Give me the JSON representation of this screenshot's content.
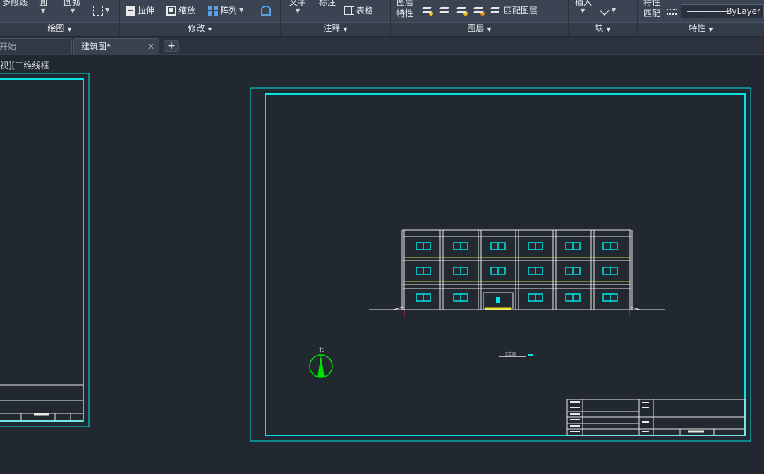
{
  "ribbon": {
    "draw": {
      "polyline_label": "多段线",
      "circle_label": "圆",
      "arc_label": "圆弧",
      "panel_title": "绘图"
    },
    "modify": {
      "stretch_label": "拉伸",
      "scale_label": "缩放",
      "array_label": "阵列",
      "panel_title": "修改"
    },
    "annotation": {
      "text_label": "文字",
      "dimension_label": "标注",
      "table_label": "表格",
      "panel_title": "注释"
    },
    "layers": {
      "layer_props_line1": "图层",
      "layer_props_line2": "特性",
      "match_layer_label": "匹配图层",
      "panel_title": "图层"
    },
    "block": {
      "insert_label": "插入",
      "panel_title": "块"
    },
    "properties": {
      "match_line1": "特性",
      "match_line2": "匹配",
      "linetype_value": "ByLayer",
      "panel_title": "特性"
    }
  },
  "tabs": [
    {
      "label": "开始",
      "active": false
    },
    {
      "label": "建筑图*",
      "active": true
    }
  ],
  "viewport_label": "视][二维线框",
  "drawing": {
    "north_label": "北",
    "scale_label": "正立面",
    "colors": {
      "frame": "#00e5e5",
      "lines": "#e8e8e8",
      "windows": "#00e5e5",
      "band": "#c8d840",
      "door": "#e8e820",
      "north": "#00e000",
      "ground_mark": "#e03030",
      "background": "#212830"
    }
  }
}
